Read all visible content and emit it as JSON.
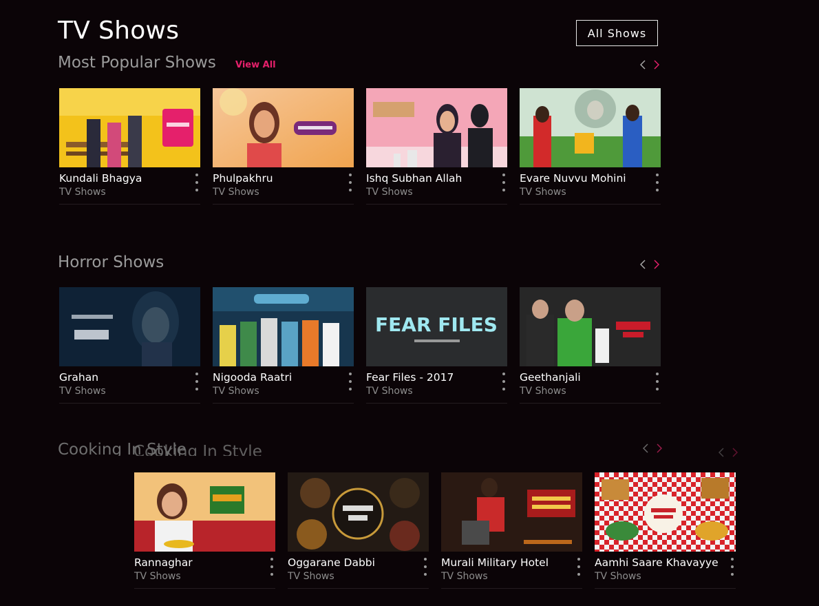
{
  "page": {
    "title": "TV Shows",
    "all_shows_label": "All Shows"
  },
  "colors": {
    "background": "#0b0407",
    "accent": "#e5206b",
    "section_title": "#9b9b9b",
    "subtitle": "#8d8d8d"
  },
  "sections": [
    {
      "title": "Most Popular Shows",
      "view_all": "View All",
      "cards": [
        {
          "title": "Kundali Bhagya",
          "subtitle": "TV Shows",
          "thumb_icon": "show-poster"
        },
        {
          "title": "Phulpakhru",
          "subtitle": "TV Shows",
          "thumb_icon": "show-poster"
        },
        {
          "title": "Ishq Subhan Allah",
          "subtitle": "TV Shows",
          "thumb_icon": "show-poster"
        },
        {
          "title": "Evare Nuvvu Mohini",
          "subtitle": "TV Shows",
          "thumb_icon": "show-poster"
        }
      ]
    },
    {
      "title": "Horror Shows",
      "cards": [
        {
          "title": "Grahan",
          "subtitle": "TV Shows",
          "thumb_icon": "show-poster"
        },
        {
          "title": "Nigooda Raatri",
          "subtitle": "TV Shows",
          "thumb_icon": "show-poster"
        },
        {
          "title": "Fear Files - 2017",
          "subtitle": "TV Shows",
          "thumb_icon": "show-poster",
          "poster_text": "FEAR FILES"
        },
        {
          "title": "Geethanjali",
          "subtitle": "TV Shows",
          "thumb_icon": "show-poster"
        }
      ]
    },
    {
      "title": "Cooking In Style",
      "cards": [
        {
          "title": "Rannaghar",
          "subtitle": "TV Shows",
          "thumb_icon": "show-poster"
        },
        {
          "title": "Oggarane Dabbi",
          "subtitle": "TV Shows",
          "thumb_icon": "show-poster"
        },
        {
          "title": "Murali Military Hotel",
          "subtitle": "TV Shows",
          "thumb_icon": "show-poster"
        },
        {
          "title": "Aamhi Saare Khavayye",
          "subtitle": "TV Shows",
          "thumb_icon": "show-poster"
        }
      ]
    }
  ]
}
